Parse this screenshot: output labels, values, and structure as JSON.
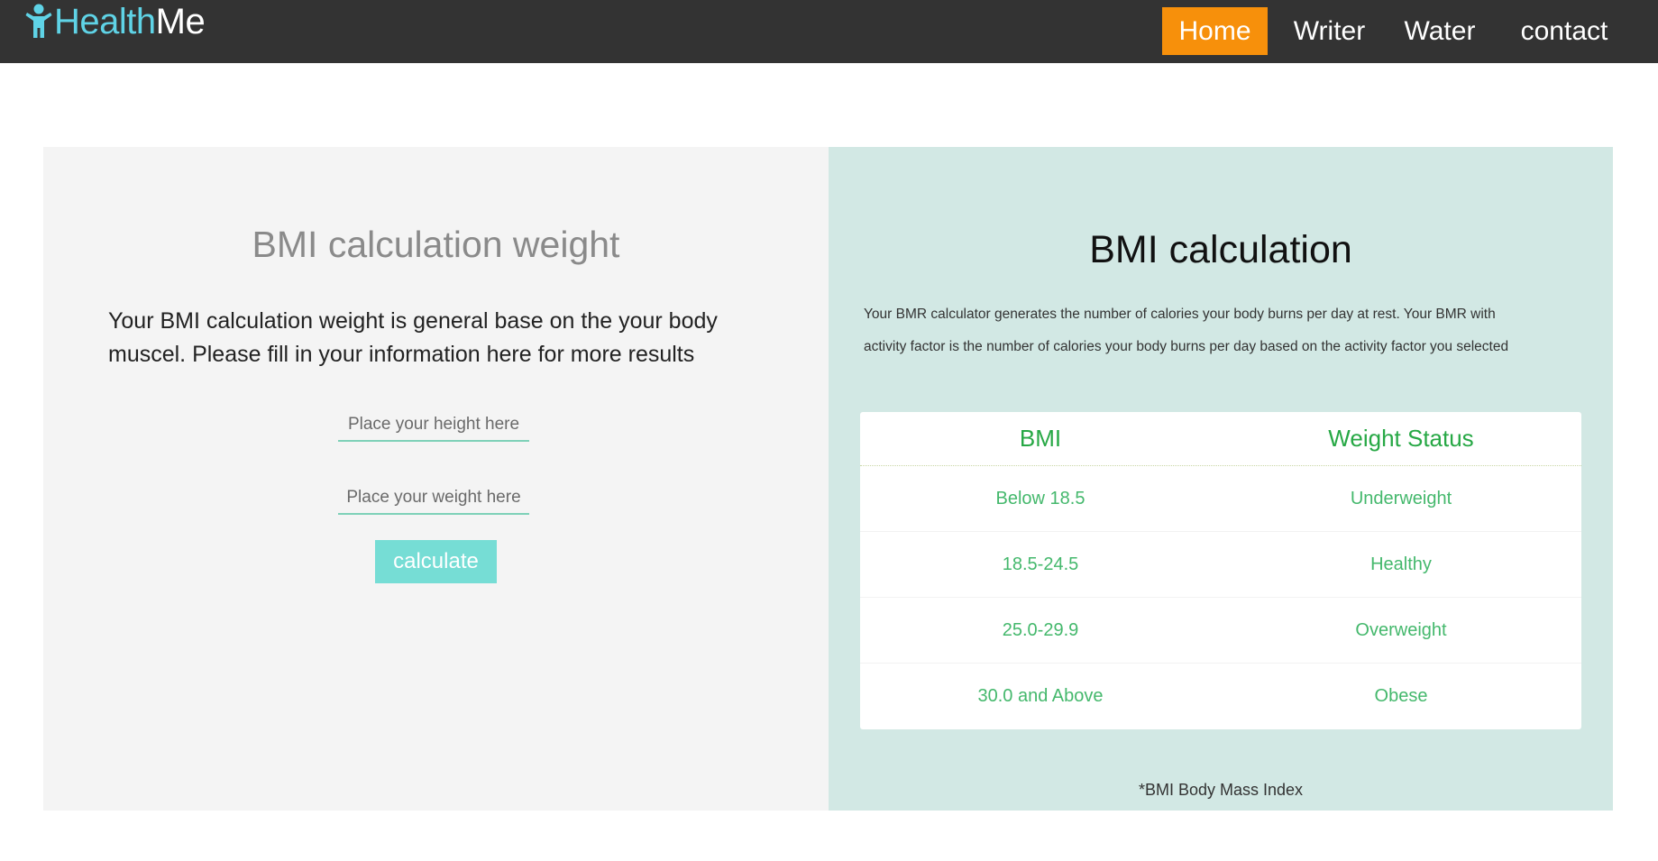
{
  "brand": {
    "name_part1": "Health",
    "name_part2": "Me"
  },
  "nav": {
    "items": [
      {
        "label": "Home",
        "active": true
      },
      {
        "label": "Writer",
        "active": false
      },
      {
        "label": "Water",
        "active": false
      },
      {
        "label": "contact",
        "active": false
      }
    ]
  },
  "left": {
    "title": "BMI calculation weight",
    "description": "Your BMI calculation weight is general base on the your body muscel. Please fill in your information here for more results",
    "height_placeholder": "Place your height here",
    "weight_placeholder": "Place your weight here",
    "calculate_label": "calculate"
  },
  "right": {
    "title": "BMI calculation",
    "description": "Your BMR calculator generates the number of calories your body burns per day at rest. Your BMR with activity factor is the number of calories your body burns per day based on the activity factor you selected",
    "table": {
      "headers": [
        "BMI",
        "Weight Status"
      ],
      "rows": [
        [
          "Below 18.5",
          "Underweight"
        ],
        [
          "18.5-24.5",
          "Healthy"
        ],
        [
          "25.0-29.9",
          "Overweight"
        ],
        [
          "30.0 and Above",
          "Obese"
        ]
      ]
    },
    "footnote": "*BMI Body Mass Index"
  },
  "colors": {
    "navbar_bg": "#333333",
    "nav_active_bg": "#f7900b",
    "brand_accent": "#5fd3e6",
    "left_panel_bg": "#f4f4f4",
    "right_panel_bg": "#d2e8e4",
    "button_bg": "#76ddd5",
    "table_header_text": "#27a845",
    "table_cell_text": "#44b86c"
  },
  "icons": {
    "brand": "person-icon"
  }
}
